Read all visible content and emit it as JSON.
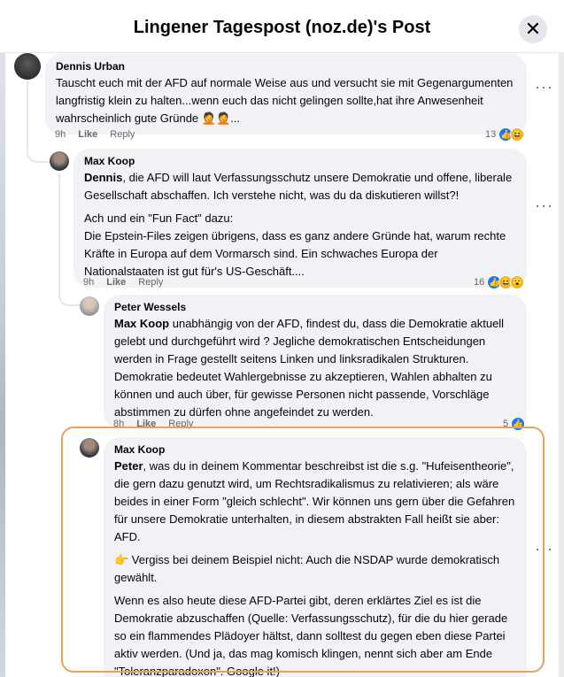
{
  "header": {
    "title": "Lingener Tagespost (noz.de)'s Post",
    "close_icon": "close-icon"
  },
  "comments": [
    {
      "author": "Dennis Urban",
      "text": "Tauscht euch mit der AFD auf normale Weise aus und versucht sie mit Gegenargumenten langfristig klein zu halten...wenn euch das nicht gelingen sollte,hat ihre Anwesenheit wahrscheinlich gute Gründe 🤦🤦...",
      "time": "9h",
      "like": "Like",
      "reply": "Reply",
      "reactions": "13"
    },
    {
      "author": "Max Koop",
      "mention": "Dennis",
      "text1": ", die AFD will laut Verfassungsschutz unsere Demokratie und offene, liberale Gesellschaft abschaffen. Ich verstehe nicht, was du da diskutieren willst?!",
      "text2": "Ach und ein \"Fun Fact\" dazu:",
      "text3": "Die Epstein-Files zeigen übrigens, dass es ganz andere Gründe hat, warum rechte Kräfte in Europa auf dem Vormarsch sind. Ein schwaches Europa der Nationalstaaten ist gut für's US-Geschäft....",
      "time": "9h",
      "like": "Like",
      "reply": "Reply",
      "reactions": "16"
    },
    {
      "author": "Peter Wessels",
      "mention": "Max Koop",
      "text": " unabhängig von der AFD, findest du, dass die Demokratie aktuell gelebt und durchgeführt wird ? Jegliche demokratischen Entscheidungen werden in Frage gestellt seitens Linken und linksradikalen Strukturen. Demokratie bedeutet Wahlergebnisse zu akzeptieren, Wahlen abhalten zu können und auch über, für gewisse Personen nicht passende, Vorschläge abstimmen zu dürfen ohne angefeindet zu werden.",
      "time": "8h",
      "like": "Like",
      "reply": "Reply",
      "reactions": "5"
    },
    {
      "author": "Max Koop",
      "mention": "Peter",
      "text1": ", was du in deinem Kommentar beschreibst ist die s.g. \"Hufeisentheorie\", die gern dazu genutzt wird, um Rechtsradikalismus zu relativieren; als wäre beides in einer Form \"gleich schlecht\". Wir können uns gern über die Gefahren für unsere Demokratie unterhalten, in diesem abstrakten Fall heißt sie aber: AFD.",
      "text2": "👉 Vergiss bei deinem Beispiel nicht: Auch die NSDAP wurde demokratisch gewählt.",
      "text3": "Wenn es also heute diese AFD-Partei gibt, deren erklärtes Ziel es ist die Demokratie abzuschaffen (Quelle: Verfassungsschutz), für die du hier gerade so ein flammendes Plädoyer hältst, dann solltest du gegen eben diese Partei aktiv werden. (Und ja, das mag komisch klingen, nennt sich aber am Ende \"Toleranzparadoxon\". Google it!)"
    }
  ],
  "icons": {
    "more": "more-options-icon",
    "like": "like-reaction-icon",
    "haha": "haha-reaction-icon",
    "wow": "wow-reaction-icon"
  },
  "colors": {
    "highlight": "#e8a05c",
    "bubble": "#f0f2f5",
    "like": "#1877f2"
  }
}
